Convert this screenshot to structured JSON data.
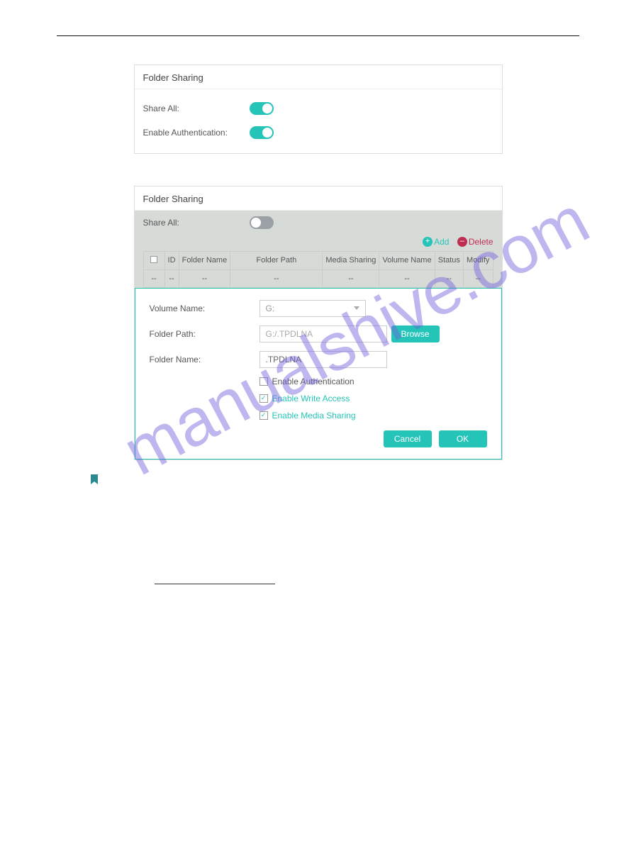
{
  "watermark_text": "manualshive.com",
  "panel1": {
    "title": "Folder Sharing",
    "share_all_label": "Share All:",
    "enable_auth_label": "Enable Authentication:"
  },
  "panel2": {
    "title": "Folder Sharing",
    "share_all_label": "Share All:",
    "add_label": "Add",
    "delete_label": "Delete",
    "table": {
      "headers": [
        "ID",
        "Folder Name",
        "Folder Path",
        "Media Sharing",
        "Volume Name",
        "Status",
        "Modify"
      ],
      "placeholder": "--"
    },
    "form": {
      "volume_label": "Volume Name:",
      "volume_value": "G:",
      "path_label": "Folder Path:",
      "path_value": "G:/.TPDLNA",
      "browse_label": "Browse",
      "name_label": "Folder Name:",
      "name_value": ".TPDLNA",
      "enable_auth_label": "Enable Authentication",
      "enable_write_label": "Enable Write Access",
      "enable_media_label": "Enable Media Sharing",
      "cancel_label": "Cancel",
      "ok_label": "OK"
    }
  }
}
